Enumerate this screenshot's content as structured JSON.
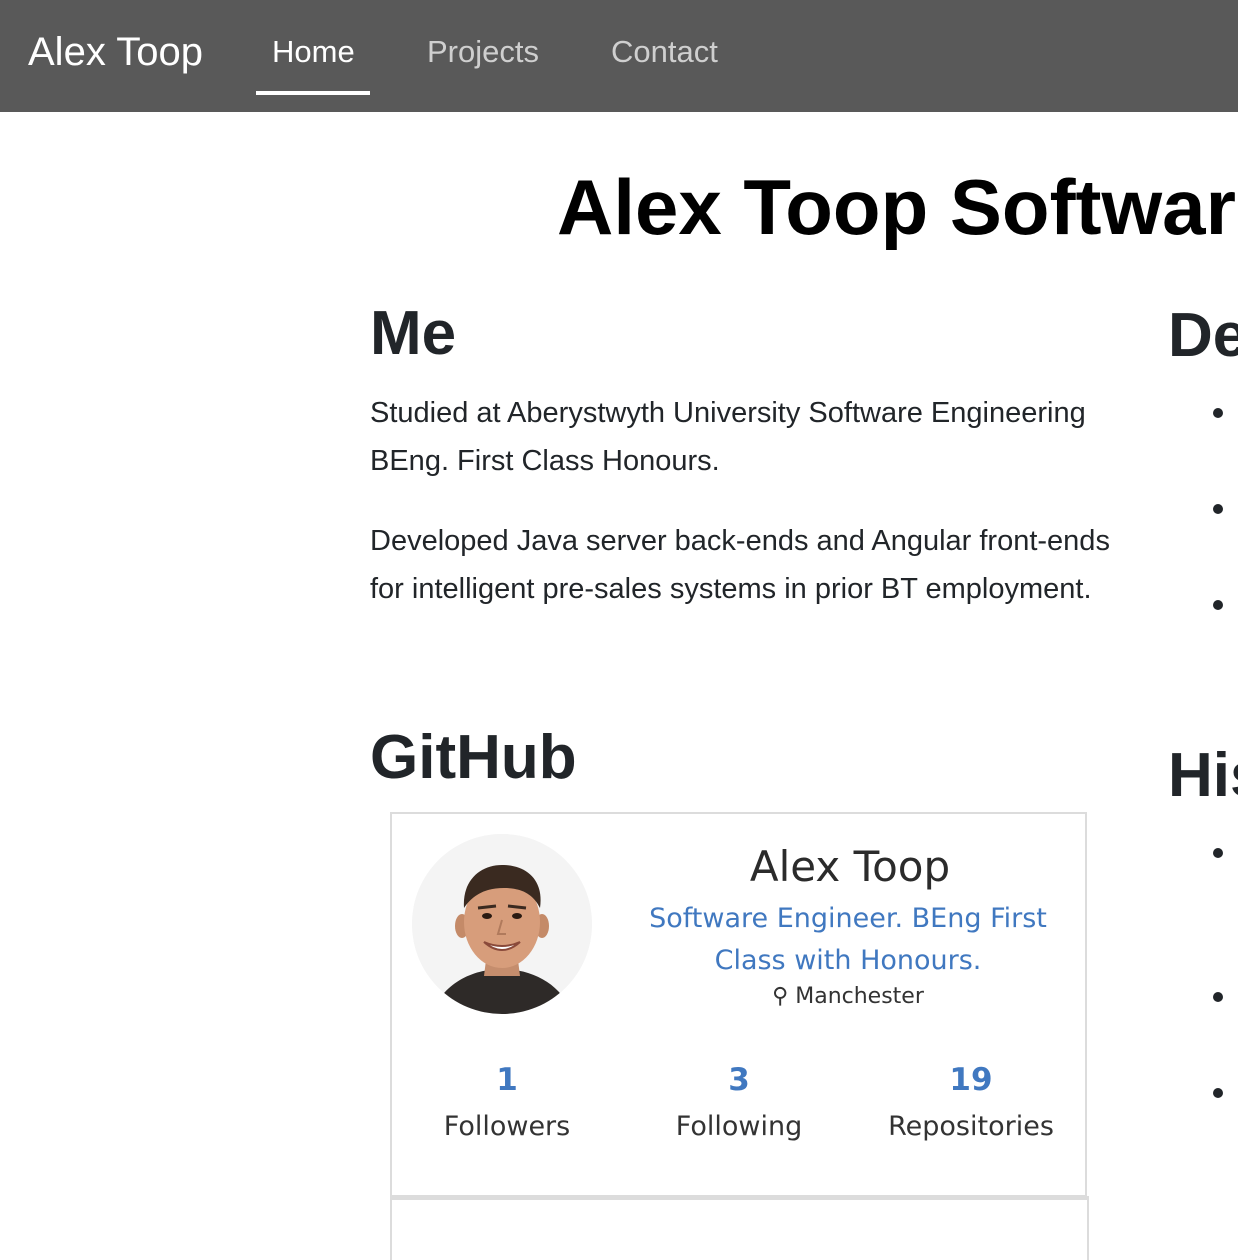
{
  "navbar": {
    "brand": "Alex Toop",
    "links": [
      {
        "label": "Home",
        "active": true
      },
      {
        "label": "Projects",
        "active": false
      },
      {
        "label": "Contact",
        "active": false
      }
    ],
    "background": "#595959"
  },
  "hero": {
    "title": "Alex Toop Software"
  },
  "me": {
    "heading": "Me",
    "paragraphs": [
      "Studied at Aberystwyth University Software Engineering BEng. First Class Honours.",
      "Developed Java server back-ends and Angular front-ends for intelligent pre-sales systems in prior BT employment."
    ]
  },
  "right_column": {
    "section1_heading": "De",
    "section2_heading": "His"
  },
  "github": {
    "heading": "GitHub",
    "name": "Alex Toop",
    "bio": "Software Engineer. BEng First Class with Honours.",
    "location_icon": "map-pin-icon",
    "location_glyph": "⚲",
    "location": "Manchester",
    "accent": "#4078c0",
    "stats": [
      {
        "value": "1",
        "label": "Followers"
      },
      {
        "value": "3",
        "label": "Following"
      },
      {
        "value": "19",
        "label": "Repositories"
      }
    ]
  }
}
